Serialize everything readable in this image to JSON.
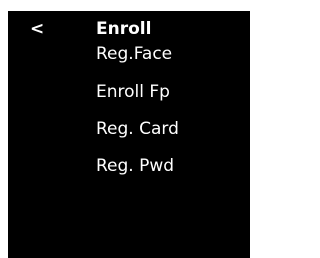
{
  "header": {
    "back_label": "<",
    "title": "Enroll"
  },
  "menu": {
    "items": [
      {
        "label": "Reg.Face"
      },
      {
        "label": "Enroll Fp"
      },
      {
        "label": "Reg. Card"
      },
      {
        "label": "Reg. Pwd"
      }
    ]
  }
}
